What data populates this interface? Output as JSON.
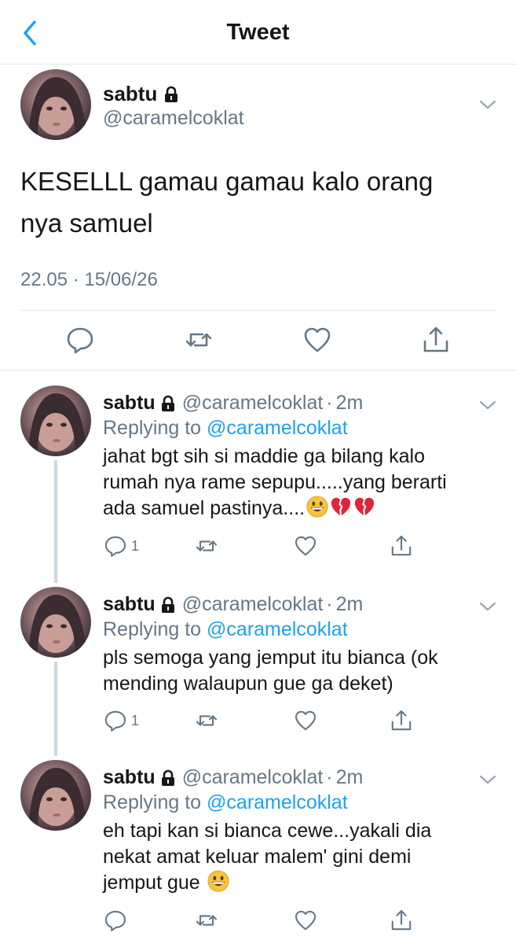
{
  "nav": {
    "title": "Tweet"
  },
  "main_tweet": {
    "name": "sabtu",
    "handle": "@caramelcoklat",
    "text_line1": "KESELLL gamau gamau kalo orang",
    "text_line2": "nya samuel",
    "timestamp": "22.05 · 15/06/26"
  },
  "replies": [
    {
      "name": "sabtu",
      "handle": "@caramelcoklat",
      "time": "2m",
      "replying_prefix": "Replying to",
      "replying_to": "@caramelcoklat",
      "line1": "jahat bgt sih si maddie ga bilang kalo",
      "line2": "rumah nya rame sepupu.....yang berarti",
      "line3": "ada samuel pastinya....",
      "reply_count": "1"
    },
    {
      "name": "sabtu",
      "handle": "@caramelcoklat",
      "time": "2m",
      "replying_prefix": "Replying to",
      "replying_to": "@caramelcoklat",
      "line1": "pls semoga yang jemput itu bianca (ok",
      "line2": "mending walaupun gue ga deket)",
      "reply_count": "1"
    },
    {
      "name": "sabtu",
      "handle": "@caramelcoklat",
      "time": "2m",
      "replying_prefix": "Replying to",
      "replying_to": "@caramelcoklat",
      "line1": "eh tapi kan si bianca cewe...yakali dia",
      "line2": "nekat amat keluar malem' gini demi",
      "line3": "jemput gue"
    }
  ],
  "colors": {
    "accent": "#1da1f2",
    "secondary_text": "#657786",
    "divider": "#e1e8ed"
  },
  "icons": [
    "back-chevron-icon",
    "lock-icon",
    "chevron-down-icon",
    "reply-icon",
    "retweet-icon",
    "like-icon",
    "share-icon",
    "grinning-emoji",
    "broken-heart-emoji"
  ]
}
